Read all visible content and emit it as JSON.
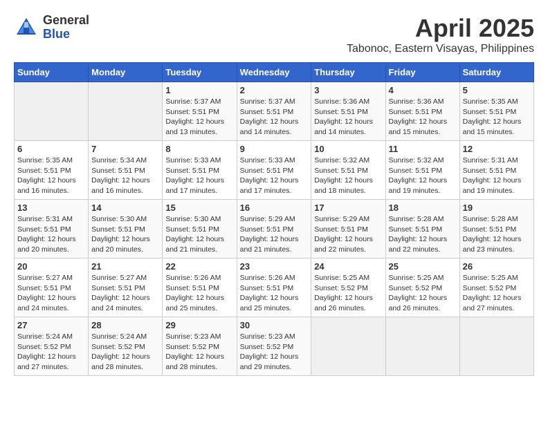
{
  "header": {
    "logo": {
      "general": "General",
      "blue": "Blue"
    },
    "title": "April 2025",
    "location": "Tabonoc, Eastern Visayas, Philippines"
  },
  "weekdays": [
    "Sunday",
    "Monday",
    "Tuesday",
    "Wednesday",
    "Thursday",
    "Friday",
    "Saturday"
  ],
  "weeks": [
    [
      {
        "day": "",
        "empty": true
      },
      {
        "day": "",
        "empty": true
      },
      {
        "day": "1",
        "sunrise": "Sunrise: 5:37 AM",
        "sunset": "Sunset: 5:51 PM",
        "daylight": "Daylight: 12 hours and 13 minutes."
      },
      {
        "day": "2",
        "sunrise": "Sunrise: 5:37 AM",
        "sunset": "Sunset: 5:51 PM",
        "daylight": "Daylight: 12 hours and 14 minutes."
      },
      {
        "day": "3",
        "sunrise": "Sunrise: 5:36 AM",
        "sunset": "Sunset: 5:51 PM",
        "daylight": "Daylight: 12 hours and 14 minutes."
      },
      {
        "day": "4",
        "sunrise": "Sunrise: 5:36 AM",
        "sunset": "Sunset: 5:51 PM",
        "daylight": "Daylight: 12 hours and 15 minutes."
      },
      {
        "day": "5",
        "sunrise": "Sunrise: 5:35 AM",
        "sunset": "Sunset: 5:51 PM",
        "daylight": "Daylight: 12 hours and 15 minutes."
      }
    ],
    [
      {
        "day": "6",
        "sunrise": "Sunrise: 5:35 AM",
        "sunset": "Sunset: 5:51 PM",
        "daylight": "Daylight: 12 hours and 16 minutes."
      },
      {
        "day": "7",
        "sunrise": "Sunrise: 5:34 AM",
        "sunset": "Sunset: 5:51 PM",
        "daylight": "Daylight: 12 hours and 16 minutes."
      },
      {
        "day": "8",
        "sunrise": "Sunrise: 5:33 AM",
        "sunset": "Sunset: 5:51 PM",
        "daylight": "Daylight: 12 hours and 17 minutes."
      },
      {
        "day": "9",
        "sunrise": "Sunrise: 5:33 AM",
        "sunset": "Sunset: 5:51 PM",
        "daylight": "Daylight: 12 hours and 17 minutes."
      },
      {
        "day": "10",
        "sunrise": "Sunrise: 5:32 AM",
        "sunset": "Sunset: 5:51 PM",
        "daylight": "Daylight: 12 hours and 18 minutes."
      },
      {
        "day": "11",
        "sunrise": "Sunrise: 5:32 AM",
        "sunset": "Sunset: 5:51 PM",
        "daylight": "Daylight: 12 hours and 19 minutes."
      },
      {
        "day": "12",
        "sunrise": "Sunrise: 5:31 AM",
        "sunset": "Sunset: 5:51 PM",
        "daylight": "Daylight: 12 hours and 19 minutes."
      }
    ],
    [
      {
        "day": "13",
        "sunrise": "Sunrise: 5:31 AM",
        "sunset": "Sunset: 5:51 PM",
        "daylight": "Daylight: 12 hours and 20 minutes."
      },
      {
        "day": "14",
        "sunrise": "Sunrise: 5:30 AM",
        "sunset": "Sunset: 5:51 PM",
        "daylight": "Daylight: 12 hours and 20 minutes."
      },
      {
        "day": "15",
        "sunrise": "Sunrise: 5:30 AM",
        "sunset": "Sunset: 5:51 PM",
        "daylight": "Daylight: 12 hours and 21 minutes."
      },
      {
        "day": "16",
        "sunrise": "Sunrise: 5:29 AM",
        "sunset": "Sunset: 5:51 PM",
        "daylight": "Daylight: 12 hours and 21 minutes."
      },
      {
        "day": "17",
        "sunrise": "Sunrise: 5:29 AM",
        "sunset": "Sunset: 5:51 PM",
        "daylight": "Daylight: 12 hours and 22 minutes."
      },
      {
        "day": "18",
        "sunrise": "Sunrise: 5:28 AM",
        "sunset": "Sunset: 5:51 PM",
        "daylight": "Daylight: 12 hours and 22 minutes."
      },
      {
        "day": "19",
        "sunrise": "Sunrise: 5:28 AM",
        "sunset": "Sunset: 5:51 PM",
        "daylight": "Daylight: 12 hours and 23 minutes."
      }
    ],
    [
      {
        "day": "20",
        "sunrise": "Sunrise: 5:27 AM",
        "sunset": "Sunset: 5:51 PM",
        "daylight": "Daylight: 12 hours and 24 minutes."
      },
      {
        "day": "21",
        "sunrise": "Sunrise: 5:27 AM",
        "sunset": "Sunset: 5:51 PM",
        "daylight": "Daylight: 12 hours and 24 minutes."
      },
      {
        "day": "22",
        "sunrise": "Sunrise: 5:26 AM",
        "sunset": "Sunset: 5:51 PM",
        "daylight": "Daylight: 12 hours and 25 minutes."
      },
      {
        "day": "23",
        "sunrise": "Sunrise: 5:26 AM",
        "sunset": "Sunset: 5:51 PM",
        "daylight": "Daylight: 12 hours and 25 minutes."
      },
      {
        "day": "24",
        "sunrise": "Sunrise: 5:25 AM",
        "sunset": "Sunset: 5:52 PM",
        "daylight": "Daylight: 12 hours and 26 minutes."
      },
      {
        "day": "25",
        "sunrise": "Sunrise: 5:25 AM",
        "sunset": "Sunset: 5:52 PM",
        "daylight": "Daylight: 12 hours and 26 minutes."
      },
      {
        "day": "26",
        "sunrise": "Sunrise: 5:25 AM",
        "sunset": "Sunset: 5:52 PM",
        "daylight": "Daylight: 12 hours and 27 minutes."
      }
    ],
    [
      {
        "day": "27",
        "sunrise": "Sunrise: 5:24 AM",
        "sunset": "Sunset: 5:52 PM",
        "daylight": "Daylight: 12 hours and 27 minutes."
      },
      {
        "day": "28",
        "sunrise": "Sunrise: 5:24 AM",
        "sunset": "Sunset: 5:52 PM",
        "daylight": "Daylight: 12 hours and 28 minutes."
      },
      {
        "day": "29",
        "sunrise": "Sunrise: 5:23 AM",
        "sunset": "Sunset: 5:52 PM",
        "daylight": "Daylight: 12 hours and 28 minutes."
      },
      {
        "day": "30",
        "sunrise": "Sunrise: 5:23 AM",
        "sunset": "Sunset: 5:52 PM",
        "daylight": "Daylight: 12 hours and 29 minutes."
      },
      {
        "day": "",
        "empty": true
      },
      {
        "day": "",
        "empty": true
      },
      {
        "day": "",
        "empty": true
      }
    ]
  ]
}
